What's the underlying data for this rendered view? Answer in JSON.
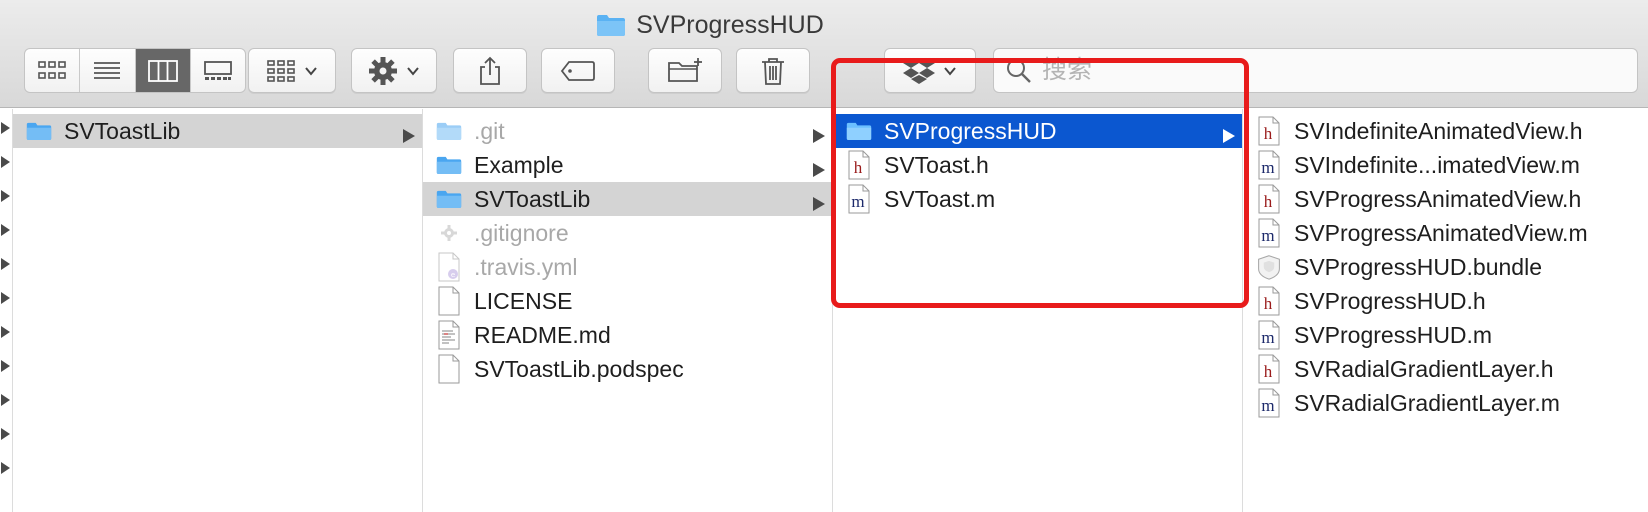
{
  "window": {
    "title": "SVProgressHUD",
    "title_icon": "folder-icon"
  },
  "toolbar": {
    "view_buttons": [
      {
        "name": "icon-view",
        "icon": "grid-icon"
      },
      {
        "name": "list-view",
        "icon": "list-icon"
      },
      {
        "name": "column-view",
        "icon": "columns-icon",
        "active": true
      },
      {
        "name": "gallery-view",
        "icon": "gallery-icon"
      }
    ],
    "search": {
      "placeholder": "搜索",
      "value": ""
    }
  },
  "columns": [
    {
      "items": [
        {
          "name": "SVToastLib",
          "icon": "folder-icon",
          "state": "selected-gray",
          "has_children": true
        }
      ]
    },
    {
      "items": [
        {
          "name": ".git",
          "icon": "folder-icon",
          "dim": true,
          "has_children": true
        },
        {
          "name": "Example",
          "icon": "folder-icon",
          "has_children": true
        },
        {
          "name": "SVToastLib",
          "icon": "folder-icon",
          "state": "selected-gray",
          "has_children": true
        },
        {
          "name": ".gitignore",
          "icon": "gear-file-icon",
          "dim": true
        },
        {
          "name": ".travis.yml",
          "icon": "yml-file-icon",
          "dim": true
        },
        {
          "name": "LICENSE",
          "icon": "document-icon"
        },
        {
          "name": "README.md",
          "icon": "text-document-icon"
        },
        {
          "name": "SVToastLib.podspec",
          "icon": "document-icon"
        }
      ]
    },
    {
      "items": [
        {
          "name": "SVProgressHUD",
          "icon": "folder-icon",
          "state": "selected-blue",
          "has_children": true
        },
        {
          "name": "SVToast.h",
          "icon": "h-file-icon"
        },
        {
          "name": "SVToast.m",
          "icon": "m-file-icon"
        }
      ]
    },
    {
      "items": [
        {
          "name": "SVIndefiniteAnimatedView.h",
          "icon": "h-file-icon"
        },
        {
          "name": "SVIndefinite...imatedView.m",
          "icon": "m-file-icon"
        },
        {
          "name": "SVProgressAnimatedView.h",
          "icon": "h-file-icon"
        },
        {
          "name": "SVProgressAnimatedView.m",
          "icon": "m-file-icon"
        },
        {
          "name": "SVProgressHUD.bundle",
          "icon": "bundle-icon"
        },
        {
          "name": "SVProgressHUD.h",
          "icon": "h-file-icon"
        },
        {
          "name": "SVProgressHUD.m",
          "icon": "m-file-icon"
        },
        {
          "name": "SVRadialGradientLayer.h",
          "icon": "h-file-icon"
        },
        {
          "name": "SVRadialGradientLayer.m",
          "icon": "m-file-icon"
        }
      ]
    }
  ],
  "colors": {
    "selection_blue": "#0b57d0",
    "selection_gray": "#d4d4d4",
    "highlight_red": "#e81b1b",
    "folder_blue": "#4aa6f0"
  }
}
